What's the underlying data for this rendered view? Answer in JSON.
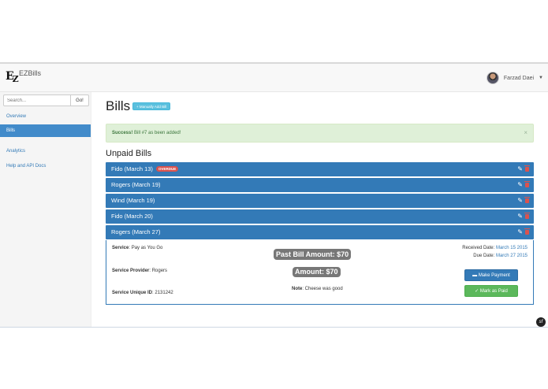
{
  "app": {
    "brand": "EZBills",
    "logo_text": "E"
  },
  "user": {
    "name": "Farzad Daei"
  },
  "search": {
    "placeholder": "Search...",
    "button": "Go!"
  },
  "sidebar": {
    "items": [
      {
        "label": "Overview"
      },
      {
        "label": "Bills"
      },
      {
        "label": "Analytics"
      },
      {
        "label": "Help and API Docs"
      }
    ]
  },
  "main": {
    "title": "Bills",
    "add_button": "+ Manually Add Bill",
    "alert": {
      "strong": "Success!",
      "text": " Bill #7 as been added!",
      "close": "×"
    },
    "section_title": "Unpaid Bills",
    "bills": [
      {
        "label": "Fido (March 13)",
        "badge": "OVERDUE"
      },
      {
        "label": "Rogers (March 19)"
      },
      {
        "label": "Wind (March 19)"
      },
      {
        "label": "Fido (March 20)"
      },
      {
        "label": "Rogers (March 27)"
      }
    ],
    "detail": {
      "service_label": "Service",
      "service_value": ": Pay as You Go",
      "provider_label": "Service Provider",
      "provider_value": ": Rogers",
      "uid_label": "Service Unique ID",
      "uid_value": ": 2131242",
      "past_amount": "Past Bill Amount: $70",
      "amount": "Amount: $70",
      "note_label": "Note",
      "note_value": ": Cheese was good",
      "received_label": "Received Date: ",
      "received_value": "March 15 2015",
      "due_label": "Due Date: ",
      "due_value": "March 27 2015",
      "pay_button": "Make Payment",
      "paid_button": "Mark as Paid"
    }
  },
  "colors": {
    "primary": "#337ab7",
    "success": "#5cb85c",
    "danger": "#d9534f",
    "info": "#5bc0de"
  }
}
